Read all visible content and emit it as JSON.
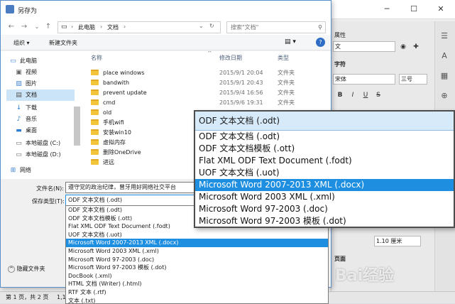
{
  "writer": {
    "sidebar_heading": "属性",
    "style_value": "文",
    "char_section": "字符",
    "font_value": "宋体",
    "size_value": "三号",
    "size_option_preview": "1.10 厘米",
    "page_section": "页面",
    "status_left": "第 1 页，共 2 页",
    "status_number": "1,1"
  },
  "dialog": {
    "title": "另存为",
    "breadcrumb": [
      "此电脑",
      "文档"
    ],
    "search_placeholder": "搜索\"文档\"",
    "organize_label": "组织",
    "new_folder_label": "新建文件夹",
    "nav_items": [
      {
        "label": "此电脑",
        "icon": "computer-icon"
      },
      {
        "label": "视频",
        "icon": "video-icon"
      },
      {
        "label": "图片",
        "icon": "picture-icon"
      },
      {
        "label": "文档",
        "icon": "document-icon"
      },
      {
        "label": "下载",
        "icon": "download-icon"
      },
      {
        "label": "音乐",
        "icon": "music-icon"
      },
      {
        "label": "桌面",
        "icon": "desktop-icon"
      },
      {
        "label": "本地磁盘 (C:)",
        "icon": "drive-icon"
      },
      {
        "label": "本地磁盘 (D:)",
        "icon": "drive-icon"
      },
      {
        "label": "网络",
        "icon": "network-icon"
      }
    ],
    "columns": {
      "name": "名称",
      "date": "修改日期",
      "type": "类型"
    },
    "files": [
      {
        "name": "place windows",
        "date": "2015/9/1 20:04",
        "type": "文件夹"
      },
      {
        "name": "bandwith",
        "date": "2015/9/1 20:43",
        "type": "文件夹"
      },
      {
        "name": "prevent update",
        "date": "2015/9/4 16:56",
        "type": "文件夹"
      },
      {
        "name": "cmd",
        "date": "2015/9/6 19:31",
        "type": "文件夹"
      },
      {
        "name": "old",
        "date": "",
        "type": ""
      },
      {
        "name": "手机wifi",
        "date": "",
        "type": ""
      },
      {
        "name": "安装win10",
        "date": "",
        "type": ""
      },
      {
        "name": "虚拟内存",
        "date": "",
        "type": ""
      },
      {
        "name": "删除OneDrive",
        "date": "",
        "type": ""
      },
      {
        "name": "进远",
        "date": "",
        "type": ""
      }
    ],
    "filename_label": "文件名(N):",
    "filename_value": "遵守党的政治纪律，曾牙用好网络社交平台",
    "filetype_label": "保存类型(T):",
    "filetype_value": "ODF 文本文档 (.odt)",
    "hide_folders_label": "隐藏文件夹",
    "type_options": [
      "ODF 文本文档 (.odt)",
      "ODF 文本文档模板 (.ott)",
      "Flat XML ODF Text Document (.fodt)",
      "UOF 文本文档 (.uot)",
      "Microsoft Word 2007-2013 XML (.docx)",
      "Microsoft Word 2003 XML (.xml)",
      "Microsoft Word 97-2003 (.doc)",
      "Microsoft Word 97-2003 模板 (.dot)",
      "DocBook (.xml)",
      "HTML 文档 (Writer) (.html)",
      "RTF 文本 (.rtf)",
      "文本 (.txt)"
    ],
    "selected_index": 4
  },
  "zoom": {
    "current": "ODF 文本文档 (.odt)",
    "options": [
      "ODF 文本文档 (.odt)",
      "ODF 文本文档模板 (.ott)",
      "Flat XML ODF Text Document (.fodt)",
      "UOF 文本文档 (.uot)",
      "Microsoft Word 2007-2013 XML (.docx)",
      "Microsoft Word 2003 XML (.xml)",
      "Microsoft Word 97-2003 (.doc)",
      "Microsoft Word 97-2003 模板 (.dot)"
    ],
    "selected_index": 4
  },
  "watermark": "Bai经验",
  "colors": {
    "accent": "#1e8fe0",
    "folder": "#f3c53a",
    "zoom_header": "#d7eaf9"
  }
}
